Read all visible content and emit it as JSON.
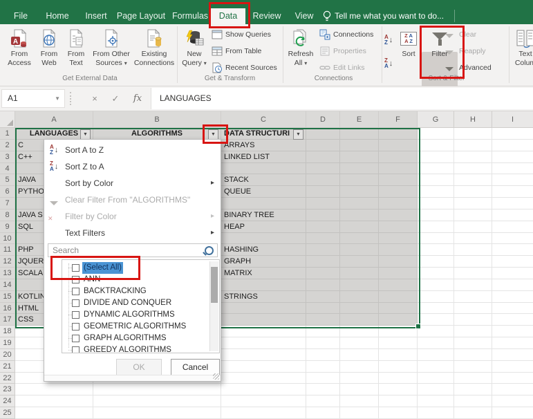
{
  "colors": {
    "excel_green": "#217346",
    "selection_border_green": "#1e7145",
    "highlight_red": "#d81512",
    "selection_fill": "#d5d4d2",
    "select_all_highlight": "#4a94d4"
  },
  "tabs": {
    "items": [
      {
        "label": "File"
      },
      {
        "label": "Home"
      },
      {
        "label": "Insert"
      },
      {
        "label": "Page Layout"
      },
      {
        "label": "Formulas"
      },
      {
        "label": "Data",
        "active": true
      },
      {
        "label": "Review"
      },
      {
        "label": "View"
      }
    ],
    "active": "Data",
    "tell_me": "Tell me what you want to do..."
  },
  "ribbon": {
    "get_external_data": {
      "label": "Get External Data",
      "from_access": "From Access",
      "from_web": "From Web",
      "from_text": "From Text",
      "from_other_sources": "From Other Sources",
      "existing_connections": "Existing Connections"
    },
    "get_transform": {
      "label": "Get & Transform",
      "new_query": "New Query",
      "show_queries": "Show Queries",
      "from_table": "From Table",
      "recent_sources": "Recent Sources"
    },
    "connections": {
      "label": "Connections",
      "refresh_all": "Refresh All",
      "connections": "Connections",
      "properties": "Properties",
      "edit_links": "Edit Links"
    },
    "sort_filter": {
      "label": "Sort & Filter",
      "sort": "Sort",
      "filter": "Filter",
      "clear": "Clear",
      "reapply": "Reapply",
      "advanced": "Advanced"
    },
    "text_to_columns": {
      "line1": "Text",
      "line2": "Colum"
    }
  },
  "formula_bar": {
    "name_box": "A1",
    "value": "LANGUAGES"
  },
  "sheet": {
    "columns": [
      "A",
      "B",
      "C",
      "D",
      "E",
      "F",
      "G",
      "H",
      "I"
    ],
    "row_count": 25,
    "selection": {
      "cols": 6,
      "rows": 17
    },
    "cells": [
      {
        "row": 1,
        "col": "A",
        "value": "LANGUAGES",
        "header": true,
        "filter": true,
        "align": "center"
      },
      {
        "row": 1,
        "col": "B",
        "value": "ALGORITHMS",
        "header": true,
        "filter": true,
        "align": "center"
      },
      {
        "row": 1,
        "col": "C",
        "value": "DATA STRUCTURI",
        "header": true,
        "filter": true
      },
      {
        "row": 2,
        "col": "A",
        "value": "C"
      },
      {
        "row": 3,
        "col": "A",
        "value": "C++"
      },
      {
        "row": 5,
        "col": "A",
        "value": "JAVA"
      },
      {
        "row": 6,
        "col": "A",
        "value": "PYTHO"
      },
      {
        "row": 8,
        "col": "A",
        "value": "JAVA S"
      },
      {
        "row": 9,
        "col": "A",
        "value": "SQL"
      },
      {
        "row": 11,
        "col": "A",
        "value": "PHP"
      },
      {
        "row": 12,
        "col": "A",
        "value": "JQUERY"
      },
      {
        "row": 13,
        "col": "A",
        "value": "SCALA"
      },
      {
        "row": 15,
        "col": "A",
        "value": "KOTLIN"
      },
      {
        "row": 16,
        "col": "A",
        "value": "HTML"
      },
      {
        "row": 17,
        "col": "A",
        "value": "CSS"
      },
      {
        "row": 2,
        "col": "C",
        "value": "ARRAYS"
      },
      {
        "row": 3,
        "col": "C",
        "value": "LINKED LIST"
      },
      {
        "row": 5,
        "col": "C",
        "value": "STACK"
      },
      {
        "row": 6,
        "col": "C",
        "value": "QUEUE"
      },
      {
        "row": 8,
        "col": "C",
        "value": "BINARY TREE"
      },
      {
        "row": 9,
        "col": "C",
        "value": "HEAP"
      },
      {
        "row": 11,
        "col": "C",
        "value": "HASHING"
      },
      {
        "row": 12,
        "col": "C",
        "value": "GRAPH"
      },
      {
        "row": 13,
        "col": "C",
        "value": "MATRIX"
      },
      {
        "row": 15,
        "col": "C",
        "value": "STRINGS"
      }
    ]
  },
  "filter_menu": {
    "items": [
      {
        "label": "Sort A to Z",
        "enabled": true,
        "submenu": false
      },
      {
        "label": "Sort Z to A",
        "enabled": true,
        "submenu": false
      },
      {
        "label": "Sort by Color",
        "enabled": true,
        "submenu": true
      },
      {
        "label": "Clear Filter From \"ALGORITHMS\"",
        "enabled": false,
        "submenu": false
      },
      {
        "label": "Filter by Color",
        "enabled": false,
        "submenu": true
      },
      {
        "label": "Text Filters",
        "enabled": true,
        "submenu": true
      }
    ],
    "search_placeholder": "Search",
    "checklist": [
      "(Select All)",
      "ANN",
      "BACKTRACKING",
      "DIVIDE AND CONQUER",
      "DYNAMIC ALGORITHMS",
      "GEOMETRIC ALGORITHMS",
      "GRAPH ALGORITHMS",
      "GREEDY ALGORITHMS"
    ],
    "selected_index": 0,
    "ok": "OK",
    "cancel": "Cancel"
  }
}
